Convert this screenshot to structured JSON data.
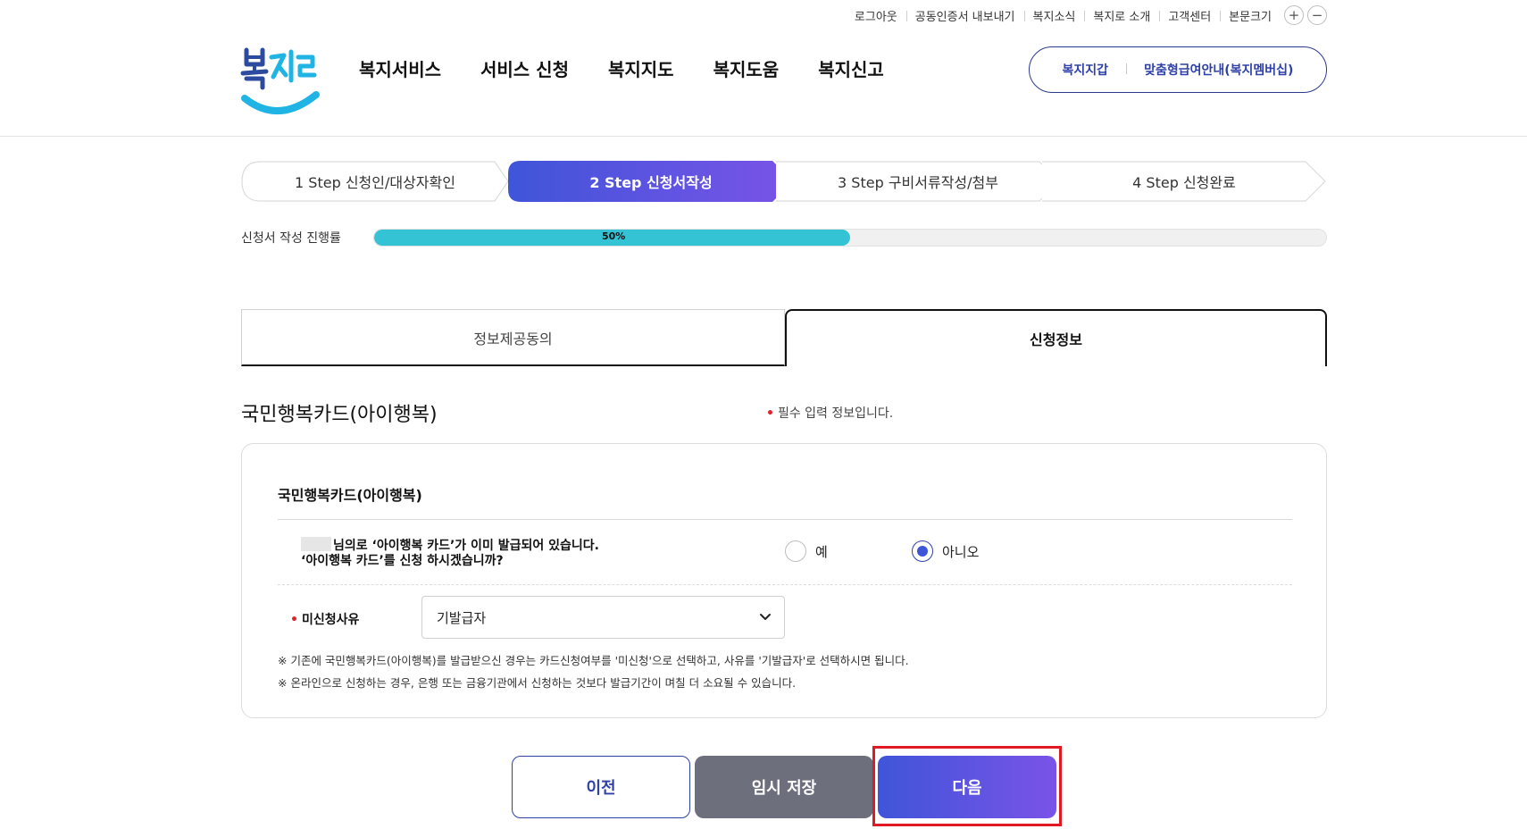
{
  "utility": {
    "logout": "로그아웃",
    "cert_export": "공동인증서 내보내기",
    "news": "복지소식",
    "about": "복지로 소개",
    "support": "고객센터",
    "text_size": "본문크기",
    "zoom_in": "+",
    "zoom_out": "−"
  },
  "gnb": {
    "items": [
      "복지서비스",
      "서비스 신청",
      "복지지도",
      "복지도움",
      "복지신고"
    ]
  },
  "header_pill": {
    "wallet": "복지지갑",
    "membership": "맞춤형급여안내(복지멤버십)"
  },
  "steps": [
    {
      "label": "1 Step 신청인/대상자확인"
    },
    {
      "label": "2 Step 신청서작성"
    },
    {
      "label": "3 Step 구비서류작성/첨부"
    },
    {
      "label": "4 Step 신청완료"
    }
  ],
  "progress": {
    "label": "신청서 작성 진행률",
    "value_text": "50%",
    "fraction": 0.5
  },
  "tabs": {
    "consent": "정보제공동의",
    "application": "신청정보"
  },
  "section": {
    "title": "국민행복카드(아이행복)",
    "required_note": "필수 입력 정보입니다.",
    "required_dot": "•"
  },
  "card": {
    "title": "국민행복카드(아이행복)",
    "question_line1": "님의로 ‘아이행복 카드’가 이미 발급되어 있습니다.",
    "question_line2": "‘아이행복 카드’를 신청 하시겠습니까?",
    "option_yes": "예",
    "option_no": "아니오",
    "reason_label": "미신청사유",
    "reason_value": "기발급자",
    "note1": "※ 기존에 국민행복카드(아이행복)를 발급받으신 경우는 카드신청여부를 '미신청'으로 선택하고, 사유를 '기발급자'로 선택하시면 됩니다.",
    "note2": "※ 온라인으로 신청하는 경우, 은행 또는 금융기관에서 신청하는 것보다 발급기간이 며칠 더 소요될 수 있습니다."
  },
  "buttons": {
    "prev": "이전",
    "save": "임시 저장",
    "next": "다음"
  },
  "colors": {
    "brand": "#3f55d9",
    "accent_purple": "#7a53e8",
    "progress": "#33c3d4",
    "required": "#e0242b",
    "highlight": "#e01a24"
  }
}
